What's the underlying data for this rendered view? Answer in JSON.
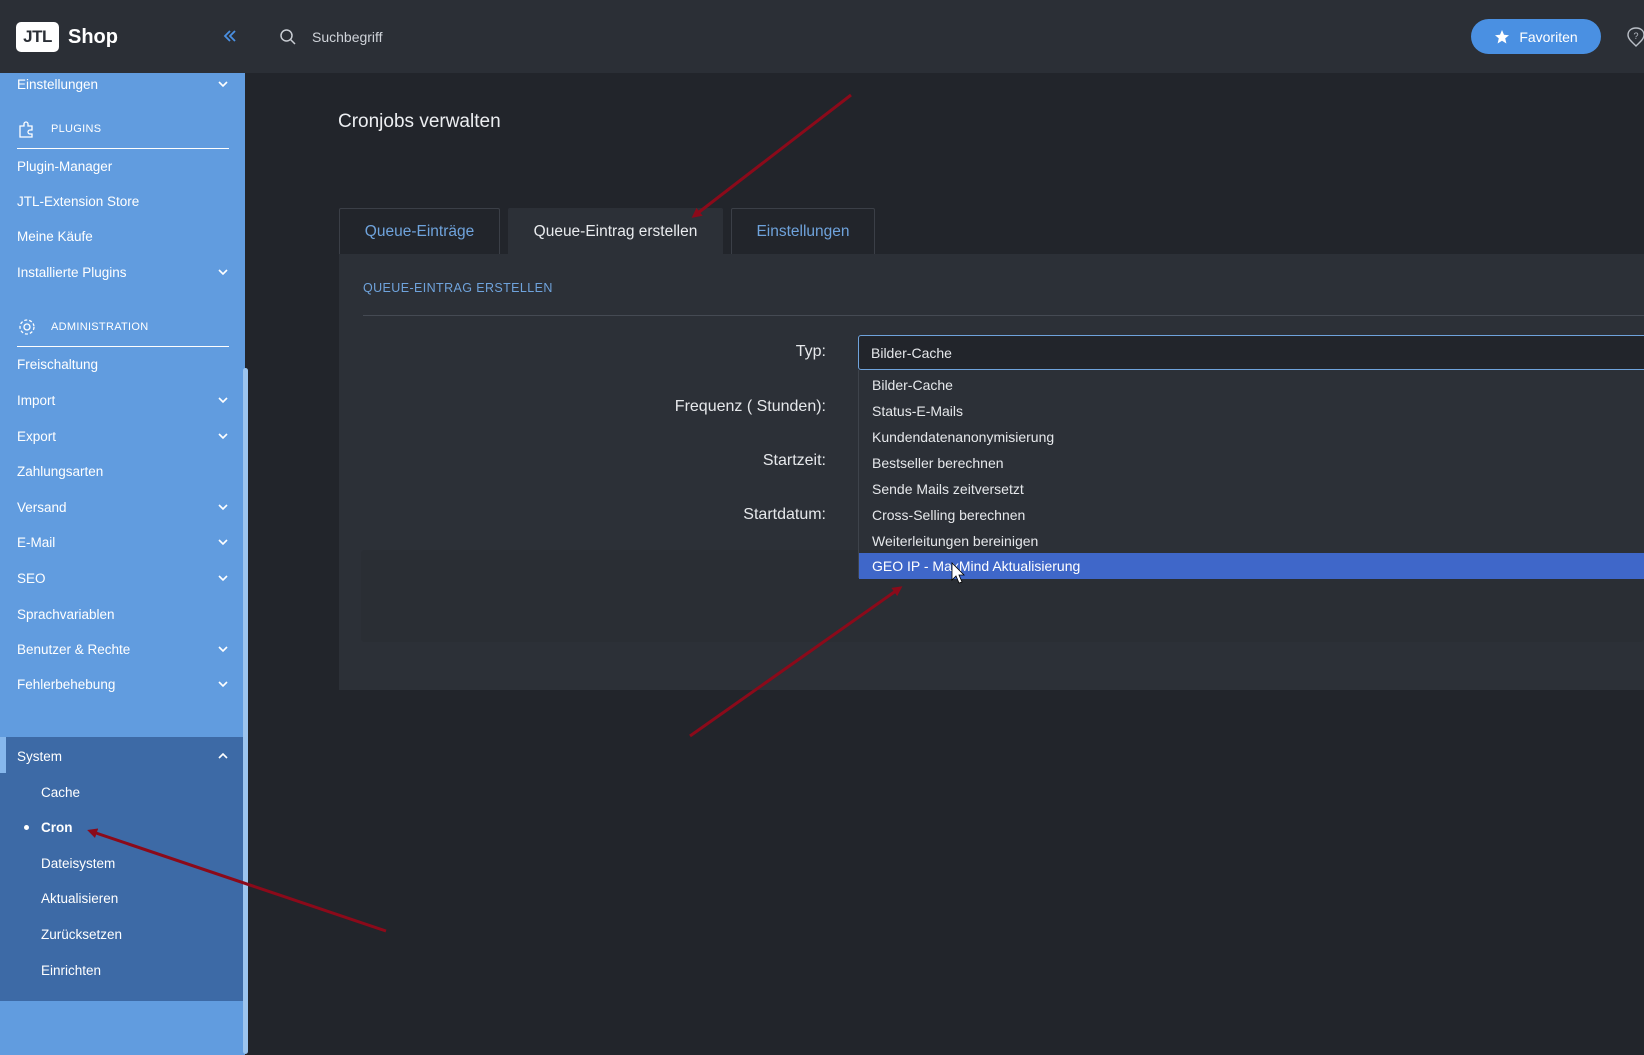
{
  "header": {
    "logo_mark": "JTL",
    "logo_text": "Shop",
    "search_placeholder": "Suchbegriff",
    "favorites_label": "Favoriten",
    "collapse_icon": "double-chevron-left-icon",
    "search_icon": "search-icon",
    "help_icon": "help-icon"
  },
  "sidebar": {
    "top_item": "Einstellungen",
    "sections": {
      "plugins": "PLUGINS",
      "administration": "ADMINISTRATION"
    },
    "plugin_items": [
      {
        "label": "Plugin-Manager"
      },
      {
        "label": "JTL-Extension Store"
      },
      {
        "label": "Meine Käufe"
      },
      {
        "label": "Installierte Plugins"
      }
    ],
    "admin_items": [
      {
        "label": "Freischaltung"
      },
      {
        "label": "Import"
      },
      {
        "label": "Export"
      },
      {
        "label": "Zahlungsarten"
      },
      {
        "label": "Versand"
      },
      {
        "label": "E-Mail"
      },
      {
        "label": "SEO"
      },
      {
        "label": "Sprachvariablen"
      },
      {
        "label": "Benutzer & Rechte"
      },
      {
        "label": "Fehlerbehebung"
      },
      {
        "label": "System"
      }
    ],
    "system_sub": [
      {
        "label": "Cache"
      },
      {
        "label": "Cron",
        "active": true
      },
      {
        "label": "Dateisystem"
      },
      {
        "label": "Aktualisieren"
      },
      {
        "label": "Zurücksetzen"
      },
      {
        "label": "Einrichten"
      }
    ]
  },
  "main": {
    "title": "Cronjobs verwalten",
    "tabs": [
      {
        "label": "Queue-Einträge"
      },
      {
        "label": "Queue-Eintrag erstellen",
        "active": true
      },
      {
        "label": "Einstellungen"
      }
    ],
    "panel_heading": "QUEUE-EINTRAG ERSTELLEN",
    "form": {
      "type_label": "Typ:",
      "frequency_label": "Frequenz ( Stunden):",
      "start_time_label": "Startzeit:",
      "start_date_label": "Startdatum:",
      "type_value": "Bilder-Cache",
      "type_options": [
        "Bilder-Cache",
        "Status-E-Mails",
        "Kundendatenanonymisierung",
        "Bestseller berechnen",
        "Sende Mails zeitversetzt",
        "Cross-Selling berechnen",
        "Weiterleitungen bereinigen",
        "GEO IP - MaxMind Aktualisierung"
      ],
      "highlighted_option": "GEO IP - MaxMind Aktualisierung"
    }
  },
  "colors": {
    "sidebar": "#619cdf",
    "sidebar_active_group": "#3d6aa6",
    "accent": "#4a90e2",
    "highlight": "#3f67c9",
    "annotation_arrow": "#8b0a1a"
  }
}
